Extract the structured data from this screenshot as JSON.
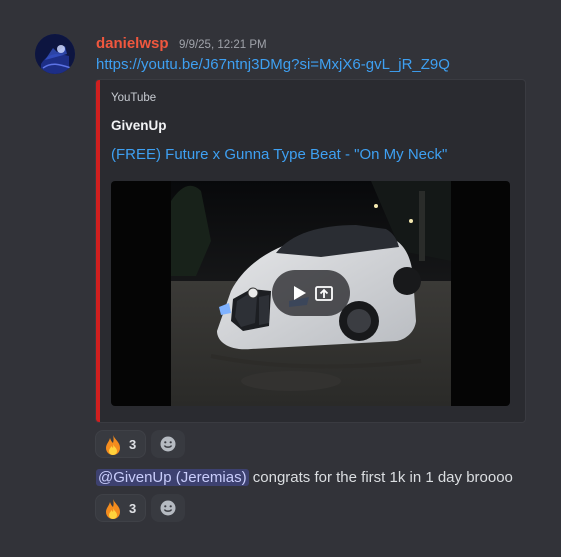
{
  "message": {
    "username": "danielwsp",
    "timestamp": "9/9/25, 12:21 PM",
    "link": "https://youtu.be/J67ntnj3DMg?si=MxjX6-gvL_jR_Z9Q",
    "embed": {
      "provider": "YouTube",
      "author": "GivenUp",
      "title": "(FREE) Future x Gunna Type Beat - \"On My Neck\"",
      "accent_color": "#d01f1f"
    },
    "reaction": {
      "emoji": "fire-emoji",
      "count": "3"
    }
  },
  "reply": {
    "mention": "@GivenUp (Jeremias)",
    "text": " congrats for the first 1k in 1 day broooo",
    "reaction": {
      "emoji": "fire-emoji",
      "count": "3"
    }
  },
  "colors": {
    "background": "#323339",
    "username": "#f0573e",
    "link": "#3ea0f2",
    "mention_bg": "#414675"
  }
}
